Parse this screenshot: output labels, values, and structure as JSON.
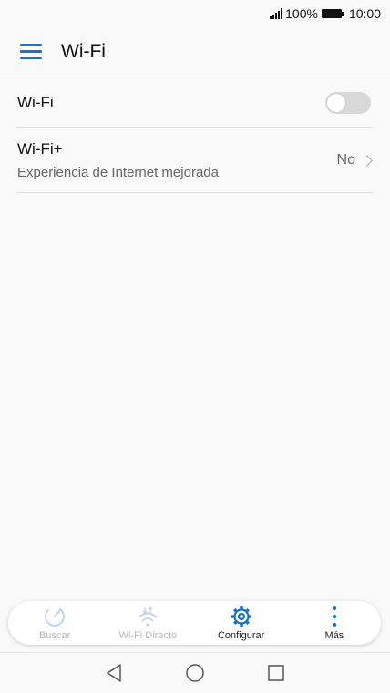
{
  "status_bar": {
    "battery": "100%",
    "time": "10:00"
  },
  "header": {
    "menu_icon": "hamburger-icon",
    "title": "Wi-Fi"
  },
  "list": {
    "wifi": {
      "label": "Wi-Fi",
      "toggle_on": false
    },
    "wifi_plus": {
      "label": "Wi-Fi+",
      "subtitle": "Experiencia de Internet mejorada",
      "value": "No"
    }
  },
  "toolbar": [
    {
      "label": "Buscar",
      "icon": "refresh-icon",
      "enabled": false
    },
    {
      "label": "Wi-Fi Directo",
      "icon": "wifi-direct-icon",
      "enabled": false
    },
    {
      "label": "Configurar",
      "icon": "gear-icon",
      "enabled": true
    },
    {
      "label": "Más",
      "icon": "more-vertical-icon",
      "enabled": true
    }
  ],
  "colors": {
    "accent": "#1a73c9",
    "disabled": "#b8b8b8",
    "toggle_off": "#d8d8d8"
  },
  "navbar": [
    "back-icon",
    "home-icon",
    "recents-icon"
  ]
}
